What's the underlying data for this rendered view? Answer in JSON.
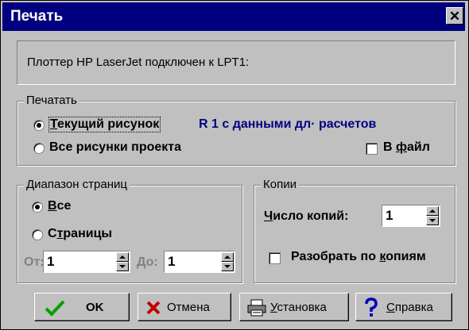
{
  "dialog": {
    "title": "Печать",
    "close_glyph": "✕"
  },
  "info": {
    "text": "Плоттер  HP LaserJet подключен к LPT1:"
  },
  "print_group": {
    "legend": "Печатать",
    "current_drawing": {
      "label": "Текущий рисунок",
      "selected": true
    },
    "drawing_name": "R 1 с данными дл· расчетов",
    "all_drawings": {
      "label": "Все рисунки проекта",
      "selected": false
    },
    "to_file": {
      "label": "В файл",
      "checked": false
    }
  },
  "range_group": {
    "legend": "Диапазон страниц",
    "all": {
      "label": "Все",
      "selected": true
    },
    "pages": {
      "label": "Страницы",
      "selected": false
    },
    "from_label": "От:",
    "from_value": "1",
    "to_label": "До:",
    "to_value": "1"
  },
  "copies_group": {
    "legend": "Копии",
    "count_label": "Число копий:",
    "count_value": "1",
    "collate": {
      "label": "Разобрать по копиям",
      "checked": false
    }
  },
  "buttons": {
    "ok": "OK",
    "cancel": "Отмена",
    "setup": "Установка",
    "help": "Справка"
  },
  "colors": {
    "title_bar": "#000080",
    "face": "#c0c0c0",
    "accent_text": "#000080",
    "ok_icon": "#00a000",
    "cancel_icon": "#c00000",
    "help_icon": "#0000c0"
  },
  "icons": {
    "ok": "check-icon",
    "cancel": "x-icon",
    "setup": "printer-icon",
    "help": "question-icon"
  }
}
